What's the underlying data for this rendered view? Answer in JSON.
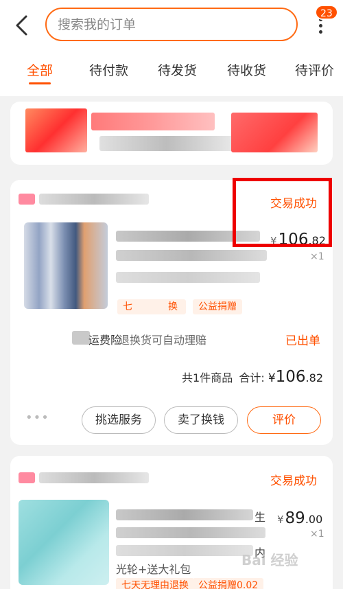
{
  "header": {
    "search_placeholder": "搜索我的订单",
    "badge_count": "23",
    "back_icon": "chevron-left-icon",
    "more_icon": "more-vertical-icon"
  },
  "tabs": [
    {
      "label": "全部",
      "active": true
    },
    {
      "label": "待付款"
    },
    {
      "label": "待发货"
    },
    {
      "label": "待收货"
    },
    {
      "label": "待评价"
    }
  ],
  "orders": [
    {
      "status": "交易成功",
      "price": {
        "currency": "¥",
        "int": "106",
        "dec": ".82"
      },
      "quantity": "×1",
      "tags": [
        "七",
        "换",
        "公益捐赠"
      ],
      "insurance_label_tail": "运费险",
      "insurance_desc": "退换货可自动理赔",
      "insurance_status": "已出单",
      "summary": {
        "count_text": "共1件商品",
        "total_label": "合计:",
        "currency": "¥",
        "int": "106",
        "dec": ".82"
      },
      "actions": {
        "more": "•••",
        "select_service": "挑选服务",
        "sell_exchange": "卖了换钱",
        "review": "评价"
      }
    },
    {
      "status": "交易成功",
      "price": {
        "currency": "¥",
        "int": "89",
        "dec": ".00"
      },
      "quantity": "×1",
      "title_fragment_1": "生",
      "title_fragment_2": "内",
      "subtitle": "光轮+送大礼包",
      "tags": [
        "七天无理由退换",
        "公益捐赠0.02"
      ]
    }
  ],
  "colors": {
    "accent": "#ff5000",
    "highlight": "#ee0000"
  },
  "watermark": "Bai 经验"
}
